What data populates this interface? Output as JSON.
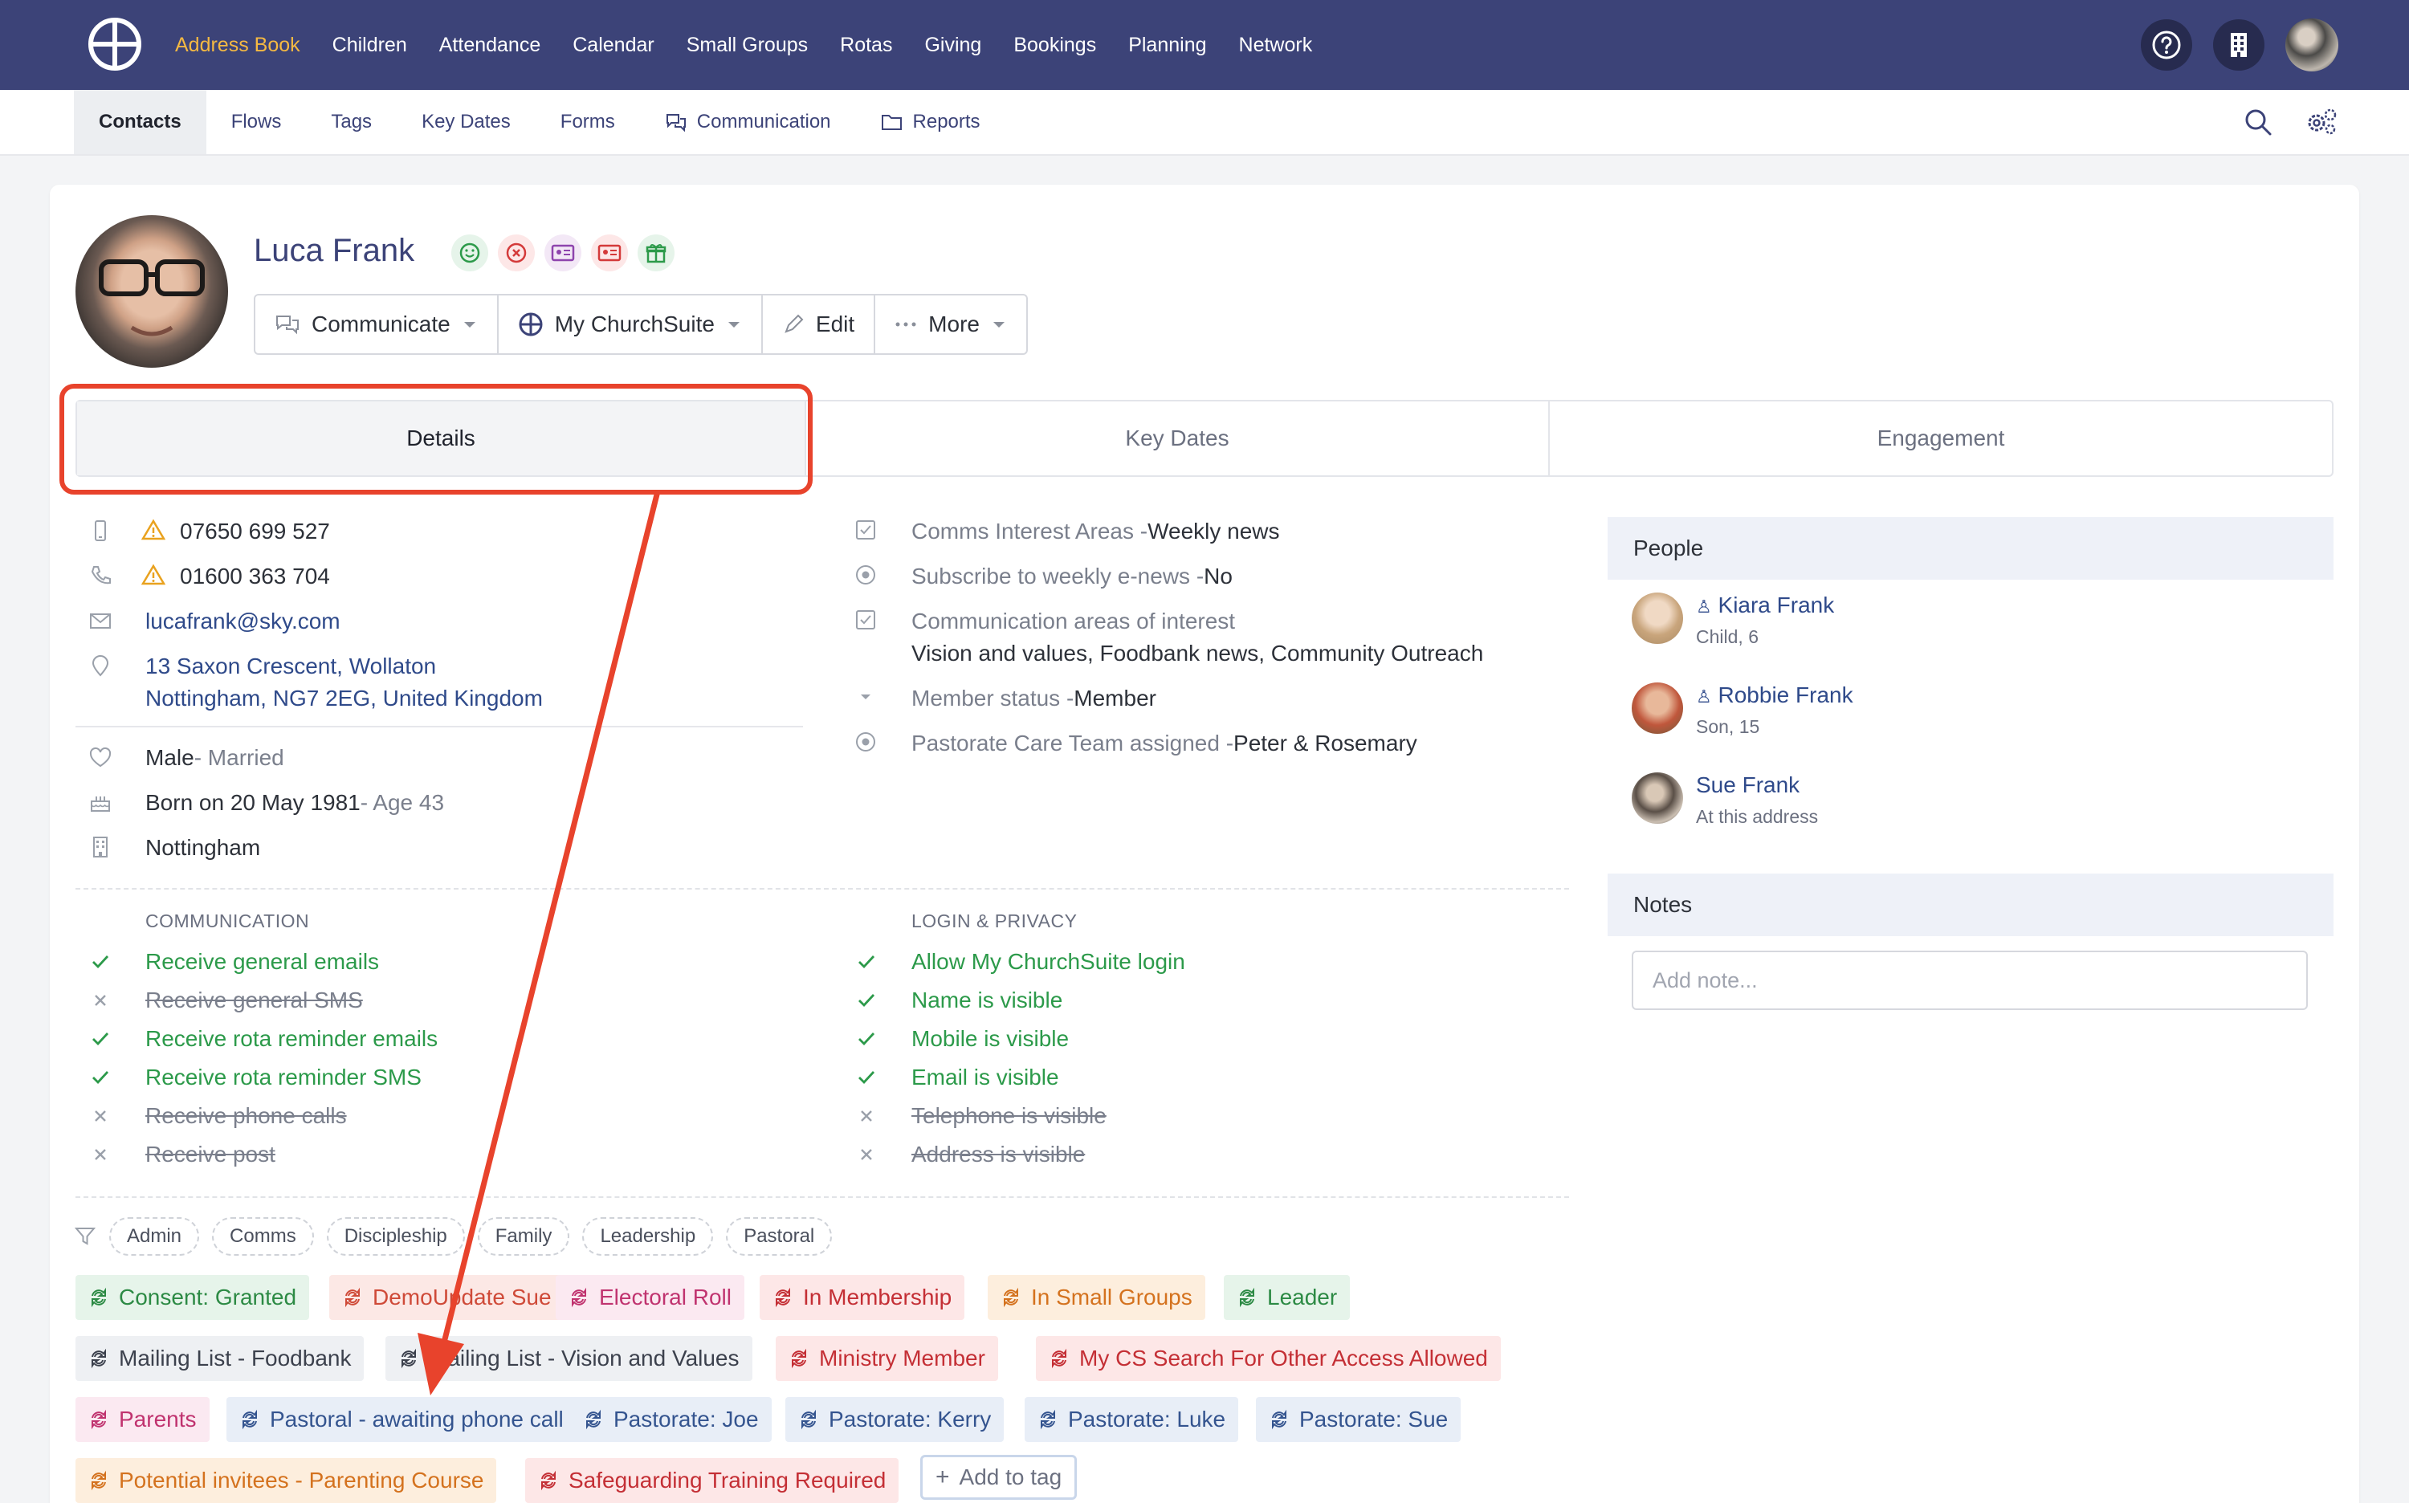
{
  "topnav": {
    "items": [
      {
        "label": "Address Book",
        "active": true
      },
      {
        "label": "Children"
      },
      {
        "label": "Attendance"
      },
      {
        "label": "Calendar"
      },
      {
        "label": "Small Groups"
      },
      {
        "label": "Rotas"
      },
      {
        "label": "Giving"
      },
      {
        "label": "Bookings"
      },
      {
        "label": "Planning"
      },
      {
        "label": "Network"
      }
    ]
  },
  "subnav": {
    "items": [
      "Contacts",
      "Flows",
      "Tags",
      "Key Dates",
      "Forms",
      "Communication",
      "Reports"
    ]
  },
  "profile": {
    "name": "Luca Frank",
    "actions": [
      "Communicate",
      "My ChurchSuite",
      "Edit",
      "More"
    ]
  },
  "tabs": [
    "Details",
    "Key Dates",
    "Engagement"
  ],
  "details": {
    "mobile": "07650 699 527",
    "phone": "01600 363 704",
    "email": "lucafrank@sky.com",
    "address1": "13 Saxon Crescent, Wollaton",
    "address2": "Nottingham, NG7 2EG, United Kingdom",
    "sex": "Male",
    "marital": " - Married",
    "born": "Born on 20 May 1981",
    "age": " - Age 43",
    "site": "Nottingham"
  },
  "fields": {
    "f1_label": "Comms Interest Areas - ",
    "f1_value": "Weekly news",
    "f2_label": "Subscribe to weekly e-news - ",
    "f2_value": "No",
    "f3_label": "Communication areas of interest",
    "f3_value": "Vision and values, Foodbank news, Community Outreach",
    "f4_label": "Member status - ",
    "f4_value": "Member",
    "f5_label": "Pastorate Care Team assigned - ",
    "f5_value": "Peter & Rosemary"
  },
  "communication": {
    "header": "COMMUNICATION",
    "items": [
      {
        "label": "Receive general emails",
        "on": true
      },
      {
        "label": "Receive general SMS",
        "on": false
      },
      {
        "label": "Receive rota reminder emails",
        "on": true
      },
      {
        "label": "Receive rota reminder SMS",
        "on": true
      },
      {
        "label": "Receive phone calls",
        "on": false
      },
      {
        "label": "Receive post",
        "on": false
      }
    ]
  },
  "privacy": {
    "header": "LOGIN & PRIVACY",
    "items": [
      {
        "label": "Allow My ChurchSuite login",
        "on": true
      },
      {
        "label": "Name is visible",
        "on": true
      },
      {
        "label": "Mobile is visible",
        "on": true
      },
      {
        "label": "Email is visible",
        "on": true
      },
      {
        "label": "Telephone is visible",
        "on": false
      },
      {
        "label": "Address is visible",
        "on": false
      }
    ]
  },
  "filters": [
    "Admin",
    "Comms",
    "Discipleship",
    "Family",
    "Leadership",
    "Pastoral"
  ],
  "tags": [
    "Consent: Granted",
    "DemoUpdate Sue",
    "Electoral Roll",
    "In Membership",
    "In Small Groups",
    "Leader",
    "Mailing List - Foodbank",
    "Mailing List - Vision and Values",
    "Ministry Member",
    "My CS Search For Other Access Allowed",
    "Parents",
    "Pastoral - awaiting phone call",
    "Pastorate: Joe",
    "Pastorate: Kerry",
    "Pastorate: Luke",
    "Pastorate: Sue",
    "Potential invitees - Parenting Course",
    "Safeguarding Training Required"
  ],
  "add_tag": "Add to tag",
  "people": {
    "header": "People",
    "items": [
      {
        "name": "Kiara Frank",
        "sub": "Child, 6"
      },
      {
        "name": "Robbie Frank",
        "sub": "Son, 15"
      },
      {
        "name": "Sue Frank",
        "sub": "At this address"
      }
    ]
  },
  "notes": {
    "header": "Notes",
    "placeholder": "Add note..."
  },
  "colors": {
    "nav_bg": "#3c4378",
    "nav_active": "#f5b942",
    "annotation_red": "#e8432c",
    "link": "#2f4a8a",
    "success_green": "#2c9a4a"
  }
}
